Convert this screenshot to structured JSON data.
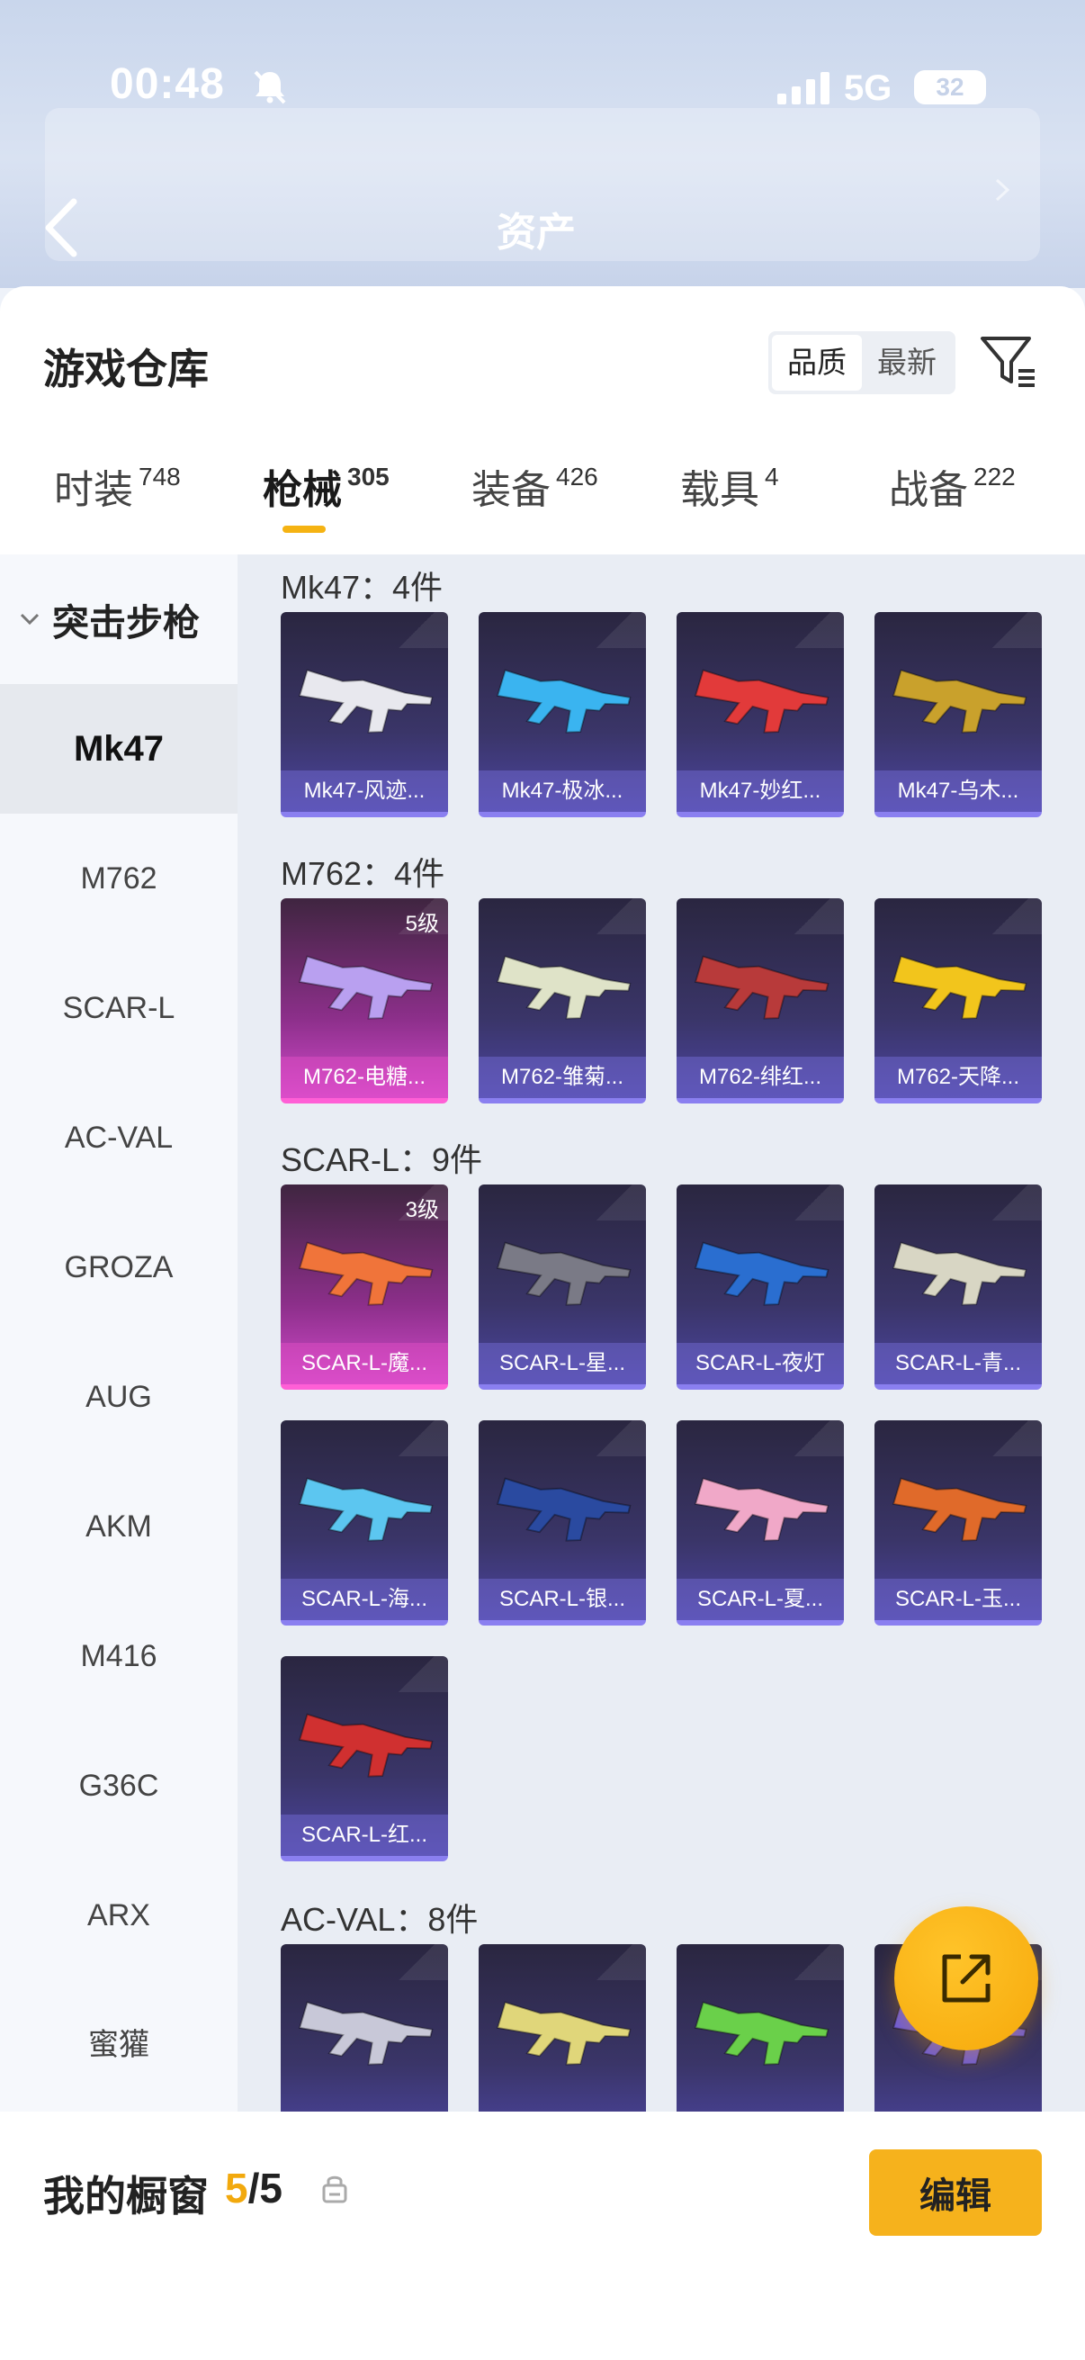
{
  "status_bar": {
    "time": "00:48",
    "network": "5G",
    "battery": "32"
  },
  "header": {
    "title": "资产"
  },
  "warehouse": {
    "title": "游戏仓库",
    "sort_options": [
      "品质",
      "最新"
    ],
    "tabs": [
      {
        "label": "时装",
        "count": "748"
      },
      {
        "label": "枪械",
        "count": "305"
      },
      {
        "label": "装备",
        "count": "426"
      },
      {
        "label": "载具",
        "count": "4"
      },
      {
        "label": "战备",
        "count": "222"
      }
    ],
    "active_tab": "枪械"
  },
  "sidebar": {
    "group": "突击步枪",
    "items": [
      "Mk47",
      "M762",
      "SCAR-L",
      "AC-VAL",
      "GROZA",
      "AUG",
      "AKM",
      "M416",
      "G36C",
      "ARX",
      "蜜獾"
    ],
    "active": "Mk47"
  },
  "sections": [
    {
      "title": "Mk47：4件",
      "items": [
        {
          "name": "Mk47-风迹...",
          "color": "#e8e8ee"
        },
        {
          "name": "Mk47-极冰...",
          "color": "#3ab4f0"
        },
        {
          "name": "Mk47-妙红...",
          "color": "#e23a3a"
        },
        {
          "name": "Mk47-乌木...",
          "color": "#c9a12c"
        }
      ]
    },
    {
      "title": "M762：4件",
      "items": [
        {
          "name": "M762-电糖...",
          "color": "#b9a0f0",
          "level": "5级",
          "rarity": "pink"
        },
        {
          "name": "M762-雏菊...",
          "color": "#dfe3c8"
        },
        {
          "name": "M762-绯红...",
          "color": "#b83a3a"
        },
        {
          "name": "M762-天降...",
          "color": "#f2c51c"
        }
      ]
    },
    {
      "title": "SCAR-L：9件",
      "items": [
        {
          "name": "SCAR-L-魔...",
          "color": "#f0743a",
          "level": "3级",
          "rarity": "pink"
        },
        {
          "name": "SCAR-L-星...",
          "color": "#7a7a86"
        },
        {
          "name": "SCAR-L-夜灯",
          "color": "#2a6ed0"
        },
        {
          "name": "SCAR-L-青...",
          "color": "#d8d6c4"
        },
        {
          "name": "SCAR-L-海...",
          "color": "#5cc6f0"
        },
        {
          "name": "SCAR-L-银...",
          "color": "#2a4aa0"
        },
        {
          "name": "SCAR-L-夏...",
          "color": "#f0a8c8"
        },
        {
          "name": "SCAR-L-玉...",
          "color": "#e06a2a"
        },
        {
          "name": "SCAR-L-红...",
          "color": "#d03030"
        }
      ]
    },
    {
      "title": "AC-VAL：8件",
      "items": [
        {
          "name": "",
          "color": "#c8c8d8"
        },
        {
          "name": "",
          "color": "#e0d67a"
        },
        {
          "name": "",
          "color": "#6ad04a"
        },
        {
          "name": "",
          "color": "#6a5ae0"
        }
      ]
    }
  ],
  "showcase": {
    "label": "我的橱窗",
    "current": "5",
    "total": "/5",
    "edit_label": "编辑"
  },
  "colors": {
    "accent": "#f6b21c",
    "card_purple": "#3a3568",
    "card_pink": "#d14acb"
  }
}
